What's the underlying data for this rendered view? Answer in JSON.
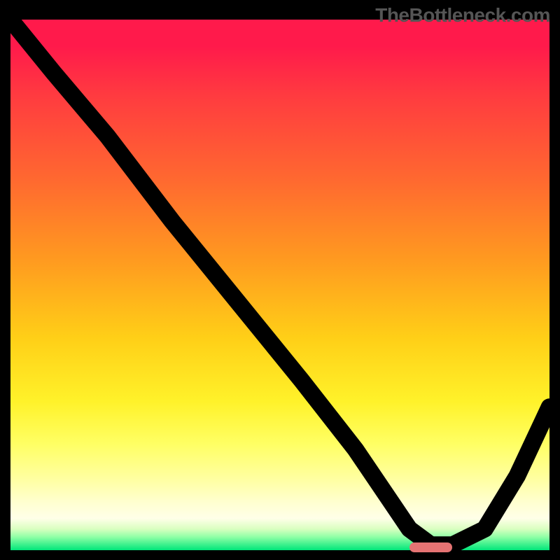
{
  "watermark": "TheBottleneck.com",
  "chart_data": {
    "type": "line",
    "title": "",
    "xlabel": "",
    "ylabel": "",
    "xlim": [
      0,
      100
    ],
    "ylim": [
      0,
      100
    ],
    "series": [
      {
        "name": "bottleneck-curve",
        "x": [
          0,
          8,
          18,
          30,
          42,
          54,
          64,
          70,
          74,
          78,
          82,
          88,
          94,
          100
        ],
        "values": [
          100,
          90,
          78,
          62,
          47,
          32,
          19,
          10,
          4,
          1,
          1,
          4,
          14,
          27
        ]
      }
    ],
    "marker": {
      "x_start": 74,
      "x_end": 82,
      "y": 0.5
    },
    "gradient_stops": [
      {
        "pct": 0,
        "color": "#ff1a4b"
      },
      {
        "pct": 60,
        "color": "#ffcf17"
      },
      {
        "pct": 85,
        "color": "#ffff9c"
      },
      {
        "pct": 100,
        "color": "#00e67a"
      }
    ]
  }
}
